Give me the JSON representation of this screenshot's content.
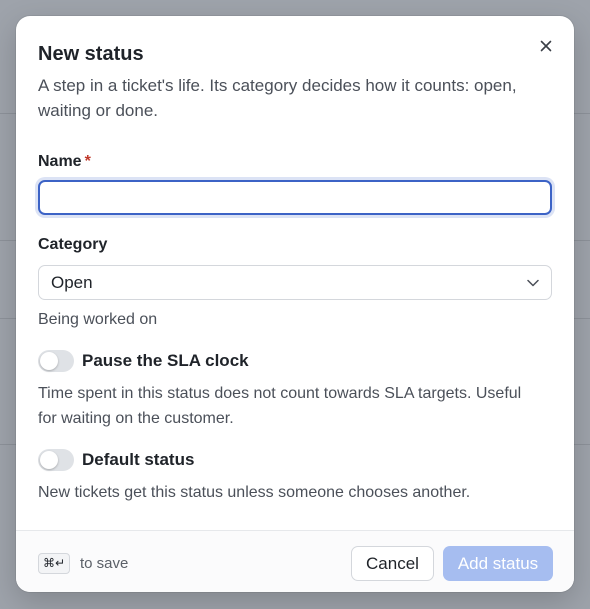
{
  "dialog": {
    "title": "New status",
    "subtitle": "A step in a ticket's life. Its category decides how it counts: open, waiting or done.",
    "close_icon": "close-icon"
  },
  "form": {
    "name_label": "Name",
    "required_marker": "*",
    "name_value": "",
    "name_placeholder": "",
    "category_label": "Category",
    "category_value": "Open",
    "category_help": "Being worked on",
    "pause_sla_label": "Pause the SLA clock",
    "pause_sla_on": false,
    "pause_sla_help": "Time spent in this status does not count towards SLA targets. Useful for waiting on the customer.",
    "default_status_label": "Default status",
    "default_status_on": false,
    "default_status_help": "New tickets get this status unless someone chooses another."
  },
  "footer": {
    "shortcut_keys": "⌘↵",
    "shortcut_hint": "to save",
    "cancel_label": "Cancel",
    "submit_label": "Add status",
    "submit_disabled": true
  },
  "colors": {
    "accent": "#3c63c6",
    "submit_disabled_bg": "#a6bdf0",
    "required": "#c0392b",
    "backdrop": "#9ea3ab"
  }
}
